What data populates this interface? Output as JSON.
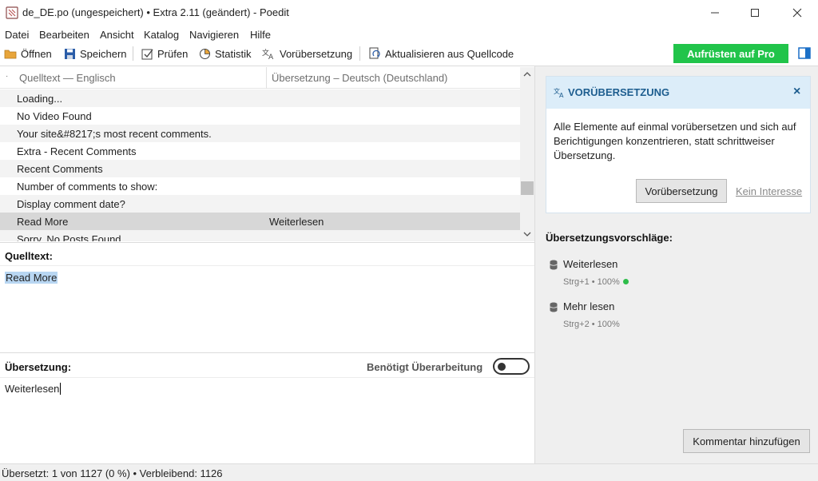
{
  "window": {
    "title": "de_DE.po (ungespeichert) • Extra 2.11 (geändert) - Poedit"
  },
  "menu": [
    "Datei",
    "Bearbeiten",
    "Ansicht",
    "Katalog",
    "Navigieren",
    "Hilfe"
  ],
  "toolbar": {
    "open": "Öffnen",
    "save": "Speichern",
    "validate": "Prüfen",
    "stats": "Statistik",
    "pretranslate": "Vorübersetzung",
    "update": "Aktualisieren aus Quellcode",
    "upgrade": "Aufrüsten auf Pro"
  },
  "list": {
    "col_source": "Quelltext — Englisch",
    "col_translation": "Übersetzung – Deutsch (Deutschland)",
    "rows": [
      {
        "source": "Loading...",
        "translation": ""
      },
      {
        "source": "No Video Found",
        "translation": ""
      },
      {
        "source": "Your site&#8217;s most recent comments.",
        "translation": ""
      },
      {
        "source": "Extra - Recent Comments",
        "translation": ""
      },
      {
        "source": "Recent Comments",
        "translation": ""
      },
      {
        "source": "Number of comments to show:",
        "translation": ""
      },
      {
        "source": "Display comment date?",
        "translation": ""
      },
      {
        "source": "Read More",
        "translation": "Weiterlesen",
        "selected": true
      },
      {
        "source": "Sorry, No Posts Found",
        "translation": ""
      }
    ]
  },
  "source_panel": {
    "label": "Quelltext:",
    "text": "Read More"
  },
  "translation_panel": {
    "label": "Übersetzung:",
    "needs_review_label": "Benötigt Überarbeitung",
    "needs_review": false,
    "text": "Weiterlesen"
  },
  "status": "Übersetzt: 1 von 1127 (0 %)  •  Verbleibend: 1126",
  "sidebar": {
    "pretranslate_card": {
      "title": "VORÜBERSETZUNG",
      "body": "Alle Elemente auf einmal vorübersetzen und sich auf Berichtigungen konzentrieren, statt schrittweiser Übersetzung.",
      "button": "Vorübersetzung",
      "dismiss": "Kein Interesse"
    },
    "suggestions_title": "Übersetzungsvorschläge:",
    "suggestions": [
      {
        "text": "Weiterlesen",
        "meta": "Strg+1 • 100%",
        "verified": true
      },
      {
        "text": "Mehr lesen",
        "meta": "Strg+2 • 100%",
        "verified": false
      }
    ],
    "comment_button": "Kommentar hinzufügen"
  },
  "colors": {
    "upgrade": "#21c44a",
    "card_header": "#dcedf9",
    "card_title": "#1d5d8f",
    "selection": "#b8d6f2"
  }
}
